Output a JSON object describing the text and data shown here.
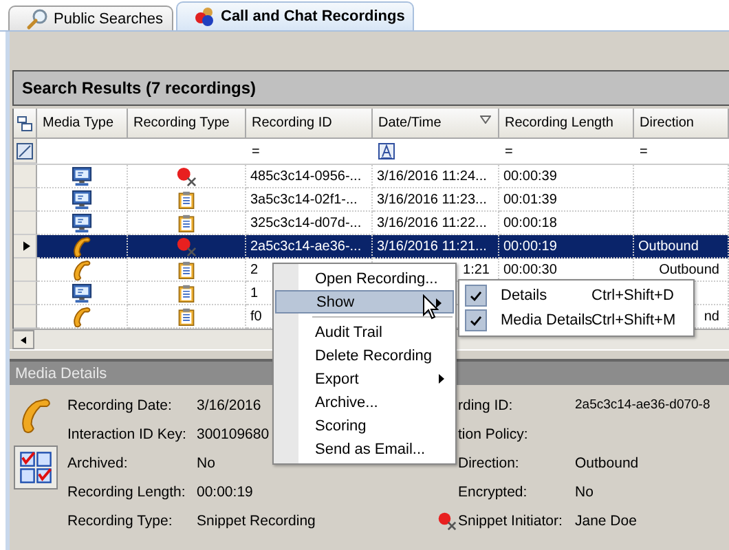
{
  "tabs": [
    {
      "label": "Public Searches",
      "kind": "search",
      "selected": false
    },
    {
      "label": "Call and Chat Recordings",
      "kind": "recordings",
      "selected": true
    }
  ],
  "results_title": "Search Results (7 recordings)",
  "table": {
    "columns": [
      {
        "label": "Media Type",
        "sorted": false
      },
      {
        "label": "Recording Type",
        "sorted": false
      },
      {
        "label": "Recording ID",
        "sorted": false,
        "filter": {
          "kind": "text",
          "text": "="
        }
      },
      {
        "label": "Date/Time",
        "sorted": true,
        "filter": {
          "kind": "date"
        }
      },
      {
        "label": "Recording Length",
        "sorted": false,
        "filter": {
          "kind": "text",
          "text": "="
        }
      },
      {
        "label": "Direction",
        "sorted": false,
        "filter": {
          "kind": "text",
          "text": "="
        }
      }
    ],
    "rows": [
      {
        "media": {
          "kind": "computer"
        },
        "recording_type": {
          "kind": "snippet"
        },
        "selected": false,
        "recording_id": "485c3c14-0956-...",
        "date_time": "3/16/2016 11:24...",
        "recording_length": "00:00:39"
      },
      {
        "media": {
          "kind": "computer"
        },
        "recording_type": {
          "kind": "clipboard"
        },
        "selected": false,
        "recording_id": "3a5c3c14-02f1-...",
        "date_time": "3/16/2016 11:23...",
        "recording_length": "00:01:39"
      },
      {
        "media": {
          "kind": "computer"
        },
        "recording_type": {
          "kind": "clipboard"
        },
        "selected": false,
        "recording_id": "325c3c14-d07d-...",
        "date_time": "3/16/2016 11:22...",
        "recording_length": "00:00:18"
      },
      {
        "media": {
          "kind": "phone"
        },
        "recording_type": {
          "kind": "snippet"
        },
        "selected": true,
        "recording_id": "2a5c3c14-ae36-...",
        "date_time": "3/16/2016 11:21...",
        "recording_length": "00:00:19",
        "direction": "Outbound"
      },
      {
        "media": {
          "kind": "phone"
        },
        "recording_type": {
          "kind": "clipboard"
        },
        "selected": false,
        "under_menu": true,
        "recording_id": "2",
        "date_time": "1:21",
        "recording_length": "00:00:30",
        "direction": "Outbound"
      },
      {
        "media": {
          "kind": "computer"
        },
        "recording_type": {
          "kind": "clipboard"
        },
        "selected": false,
        "recording_id": "1"
      },
      {
        "media": {
          "kind": "phone"
        },
        "recording_type": {
          "kind": "clipboard"
        },
        "selected": false,
        "under_menu": true,
        "recording_id": "f0",
        "direction": "nd"
      }
    ]
  },
  "details": {
    "title": "Media Details",
    "left": [
      {
        "label": "Recording Date:",
        "value": "3/16/2016"
      },
      {
        "label": "Interaction ID Key:",
        "value": "300109680"
      },
      {
        "label": "Archived:",
        "value": "No"
      },
      {
        "label": "Recording Length:",
        "value": "00:00:19"
      },
      {
        "label": "Recording Type:",
        "value": "Snippet Recording"
      }
    ],
    "right": [
      {
        "label": "rding ID:",
        "value": "2a5c3c14-ae36-d070-8",
        "kind": "plain"
      },
      {
        "label": "tion Policy:",
        "kind": "plain"
      },
      {
        "label": "Direction:",
        "value": "Outbound",
        "kind": "plain"
      },
      {
        "label": "Encrypted:",
        "value": "No",
        "kind": "plain"
      },
      {
        "label": "Snippet Initiator:",
        "value": "Jane Doe",
        "kind": "snippet"
      }
    ]
  },
  "context_menu": {
    "items": [
      {
        "kind": "item",
        "label": "Open Recording...",
        "selected": false,
        "submenu": false
      },
      {
        "kind": "item",
        "label": "Show",
        "selected": true,
        "submenu": true
      },
      {
        "kind": "separator"
      },
      {
        "kind": "item",
        "label": "Audit Trail",
        "selected": false,
        "submenu": false
      },
      {
        "kind": "item",
        "label": "Delete Recording",
        "selected": false,
        "submenu": false
      },
      {
        "kind": "item",
        "label": "Export",
        "selected": false,
        "submenu": true
      },
      {
        "kind": "item",
        "label": "Archive...",
        "selected": false,
        "submenu": false
      },
      {
        "kind": "item",
        "label": "Scoring",
        "selected": false,
        "submenu": false
      },
      {
        "kind": "item",
        "label": "Send as Email...",
        "selected": false,
        "submenu": false
      }
    ],
    "submenu": [
      {
        "label": "Details",
        "shortcut": "Ctrl+Shift+D",
        "checked": true
      },
      {
        "label": "Media Details",
        "shortcut": "Ctrl+Shift+M",
        "checked": true
      }
    ]
  }
}
